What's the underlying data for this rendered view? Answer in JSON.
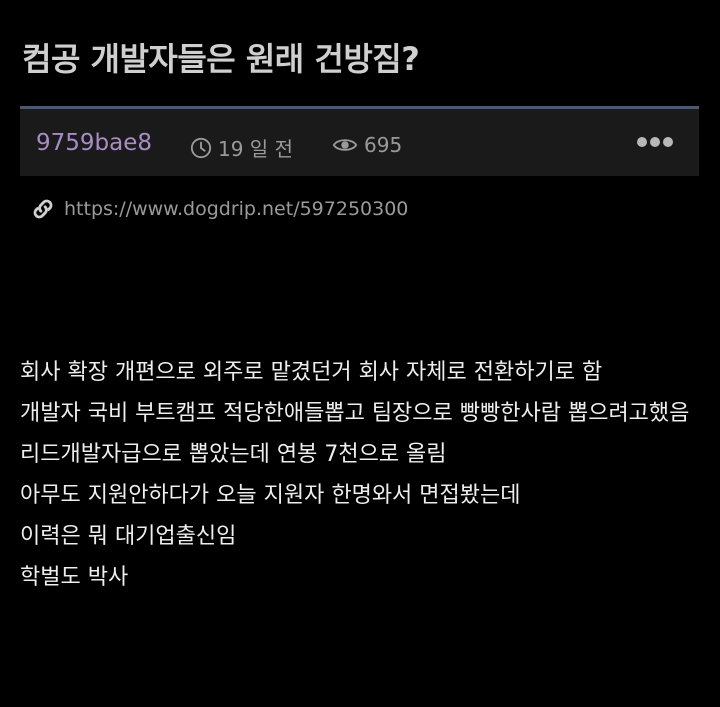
{
  "post": {
    "title": "컴공 개발자들은 원래 건방짐?",
    "author": "9759bae8",
    "time": "19 일 전",
    "views": "695",
    "url": "https://www.dogdrip.net/597250300"
  },
  "icons": {
    "time": "clock-icon",
    "views": "eye-icon",
    "link": "link-icon",
    "more": "more-dots-icon"
  },
  "colors": {
    "background": "#000000",
    "meta_bar": "#1a1a1a",
    "meta_border": "#4a5a6e",
    "author": "#a98bc7",
    "muted": "#9a9a9a",
    "title": "#cfcfcf"
  },
  "content": {
    "lines": [
      "회사 확장 개편으로 외주로 맡겼던거 회사 자체로 전환하기로 함",
      "개발자 국비 부트캠프 적당한애들뽑고 팀장으로 빵빵한사람 뽑으려고했음",
      "리드개발자급으로 뽑았는데 연봉 7천으로 올림",
      "아무도 지원안하다가 오늘 지원자 한명와서 면접봤는데",
      "이력은 뭐 대기업출신임",
      "학벌도 박사"
    ]
  }
}
